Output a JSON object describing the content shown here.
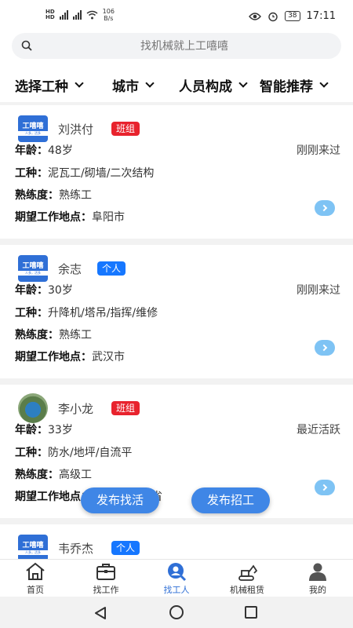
{
  "status_bar": {
    "net_speed_value": "106",
    "net_speed_unit": "B/s",
    "battery": "38",
    "time": "17:11"
  },
  "search": {
    "placeholder": "找机械就上工嘻嘻"
  },
  "filters": [
    "选择工种",
    "城市",
    "人员构成",
    "智能推荐"
  ],
  "labels": {
    "age": "年龄：",
    "trade": "工种：",
    "skill": "熟练度：",
    "location": "期望工作地点：",
    "logo_main": "工嘻嘻",
    "logo_sub": "人多，活多"
  },
  "workers": [
    {
      "name": "刘洪付",
      "badge": "班组",
      "age": "48岁",
      "activity": "刚刚来过",
      "trade": "泥瓦工/砌墙/二次结构",
      "skill": "熟练工",
      "location": "阜阳市"
    },
    {
      "name": "余志",
      "badge": "个人",
      "age": "30岁",
      "activity": "刚刚来过",
      "trade": "升降机/塔吊/指挥/维修",
      "skill": "熟练工",
      "location": "武汉市"
    },
    {
      "name": "李小龙",
      "badge": "班组",
      "age": "33岁",
      "activity": "最近活跃",
      "trade": "防水/地坪/自流平",
      "skill": "高级工",
      "location": "东省"
    },
    {
      "name": "韦乔杰",
      "badge": "个人"
    }
  ],
  "colors": {
    "accent": "#2f6fd6",
    "badge_team": "#e8232d",
    "badge_person": "#1677ff",
    "fab": "#3f86e6"
  },
  "fab": {
    "post_job_search": "发布找活",
    "post_hiring": "发布招工"
  },
  "tabs": [
    {
      "label": "首页",
      "icon": "home-icon"
    },
    {
      "label": "找工作",
      "icon": "briefcase-icon"
    },
    {
      "label": "找工人",
      "icon": "find-worker-icon",
      "active": true
    },
    {
      "label": "机械租赁",
      "icon": "excavator-icon"
    },
    {
      "label": "我的",
      "icon": "profile-icon"
    }
  ]
}
